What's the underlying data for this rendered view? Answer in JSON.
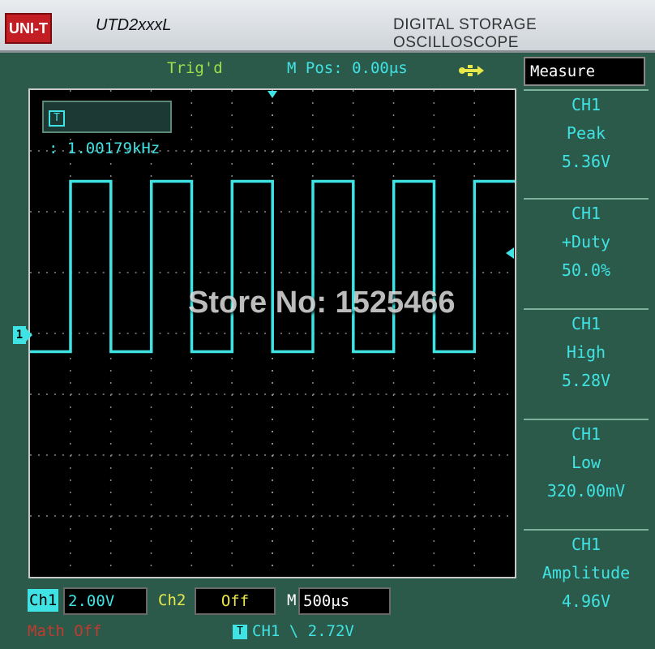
{
  "header": {
    "brand": "UNI-T",
    "model": "UTD2xxxL",
    "title": "DIGITAL STORAGE OSCILLOSCOPE"
  },
  "status": {
    "trigger_state": "Trig'd",
    "mpos": "M Pos: 0.00μs",
    "usb_icon": "usb-icon"
  },
  "screen": {
    "frequency": "1.00179kHz",
    "frequency_prefix": "T",
    "channel_marker": "1",
    "watermark": "Store No: 1525466",
    "trace_color": "#3fe3e3",
    "waveform": {
      "type": "square",
      "high_division": 2.5,
      "low_division": -0.3,
      "period_divisions": 2.0,
      "duty": 0.5
    }
  },
  "measure": {
    "title": "Measure",
    "items": [
      {
        "channel": "CH1",
        "name": "Peak",
        "value": "5.36V"
      },
      {
        "channel": "CH1",
        "name": "+Duty",
        "value": "50.0%"
      },
      {
        "channel": "CH1",
        "name": "High",
        "value": "5.28V"
      },
      {
        "channel": "CH1",
        "name": "Low",
        "value": "320.00mV"
      },
      {
        "channel": "CH1",
        "name": "Amplitude",
        "value": "4.96V"
      }
    ]
  },
  "bottom": {
    "ch1_label": "Ch1",
    "ch1_scale": "2.00V",
    "ch2_label": "Ch2",
    "ch2_scale": "Off",
    "m_label": "M",
    "timebase": "500μs",
    "math": "Math Off",
    "trigger_prefix": "T",
    "trigger_info": "CH1  \\  2.72V"
  }
}
